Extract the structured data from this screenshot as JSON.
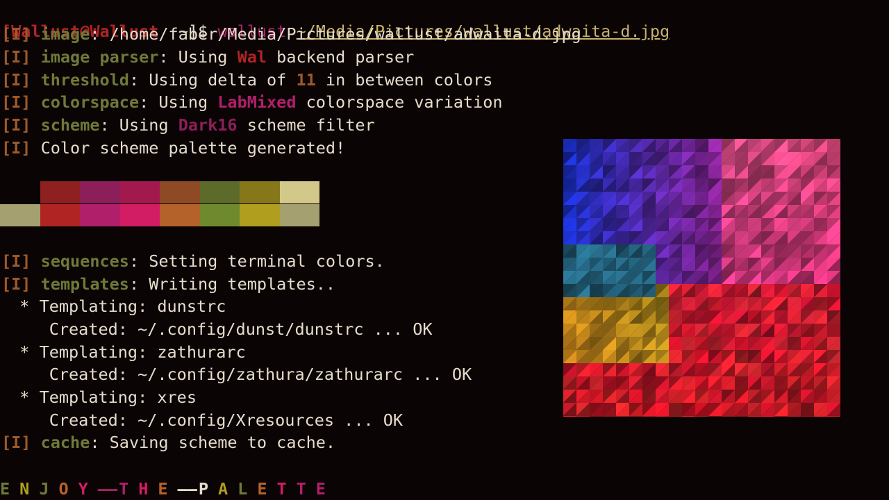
{
  "prompt": {
    "bracket_open": "[",
    "user_host": "Wallust@Wallust",
    "cwd": "~",
    "bracket_close": "]",
    "symbol": "$",
    "command": "wallust",
    "argument": "~/Media/Pictures/wallust/adwaita-d.jpg"
  },
  "log_tag": "[I]",
  "lines": {
    "image": {
      "key": "image",
      "rest": ": /home/faber/Media/Pictures/wallust/adwaita-d.jpg"
    },
    "parser": {
      "key": "image parser",
      "pre": ": Using ",
      "hl": "Wal",
      "post": " backend parser"
    },
    "threshold": {
      "key": "threshold",
      "pre": ": Using delta of ",
      "hl": "11",
      "post": " in between colors"
    },
    "colorspace": {
      "key": "colorspace",
      "pre": ": Using ",
      "hl": "LabMixed",
      "post": " colorspace variation"
    },
    "scheme": {
      "key": "scheme",
      "pre": ": Using ",
      "hl": "Dark16",
      "post": " scheme filter"
    },
    "generated": {
      "rest": " Color scheme palette generated!"
    },
    "sequences": {
      "key": "sequences",
      "rest": ": Setting terminal colors."
    },
    "templates": {
      "key": "templates",
      "rest": ": Writing templates.."
    },
    "cache": {
      "key": "cache",
      "rest": ": Saving scheme to cache."
    }
  },
  "templating": [
    {
      "label": "  * Templating: dunstrc",
      "created": "     Created: ~/.config/dunst/dunstrc ... OK"
    },
    {
      "label": "  * Templating: zathurarc",
      "created": "     Created: ~/.config/zathura/zathurarc ... OK"
    },
    {
      "label": "  * Templating: xres",
      "created": "     Created: ~/.config/Xresources ... OK"
    }
  ],
  "palette": {
    "top_row": [
      "#0b0405",
      "#8e2020",
      "#8c1f5a",
      "#a21a4d",
      "#8e4a24",
      "#5d6b2a",
      "#86781a",
      "#d2c88a"
    ],
    "bottom_row": [
      "#a5a070",
      "#b02424",
      "#b0206a",
      "#d21d64",
      "#b5612a",
      "#6f8a2e",
      "#b09e1e",
      "#a5a070"
    ]
  },
  "colors": {
    "background": "#0b0405",
    "foreground": "#e6dccb",
    "key_olive": "#6f7a38",
    "tag_brown": "#9c5a2a",
    "accent_red": "#b02424",
    "accent_pink": "#b0206a"
  },
  "banner": {
    "letters": [
      {
        "ch": "E",
        "color": "#6f7a38"
      },
      {
        "ch": "N",
        "color": "#b09e1e"
      },
      {
        "ch": "J",
        "color": "#6f7a38"
      },
      {
        "ch": "O",
        "color": "#b5612a"
      },
      {
        "ch": "Y",
        "color": "#d21d64"
      },
      {
        "ch": "——",
        "color": "#b0206a"
      },
      {
        "ch": "T",
        "color": "#b0206a"
      },
      {
        "ch": "H",
        "color": "#d21d64"
      },
      {
        "ch": "E",
        "color": "#b5612a"
      },
      {
        "ch": "——",
        "color": "#e6dccb"
      },
      {
        "ch": "P",
        "color": "#e6dccb"
      },
      {
        "ch": "A",
        "color": "#b09e1e"
      },
      {
        "ch": "L",
        "color": "#6f7a38"
      },
      {
        "ch": "E",
        "color": "#b5612a"
      },
      {
        "ch": "T",
        "color": "#d21d64"
      },
      {
        "ch": "T",
        "color": "#b0206a"
      },
      {
        "ch": "E",
        "color": "#b0206a"
      }
    ]
  },
  "preview_image": {
    "icon": "wallpaper-preview-image"
  }
}
